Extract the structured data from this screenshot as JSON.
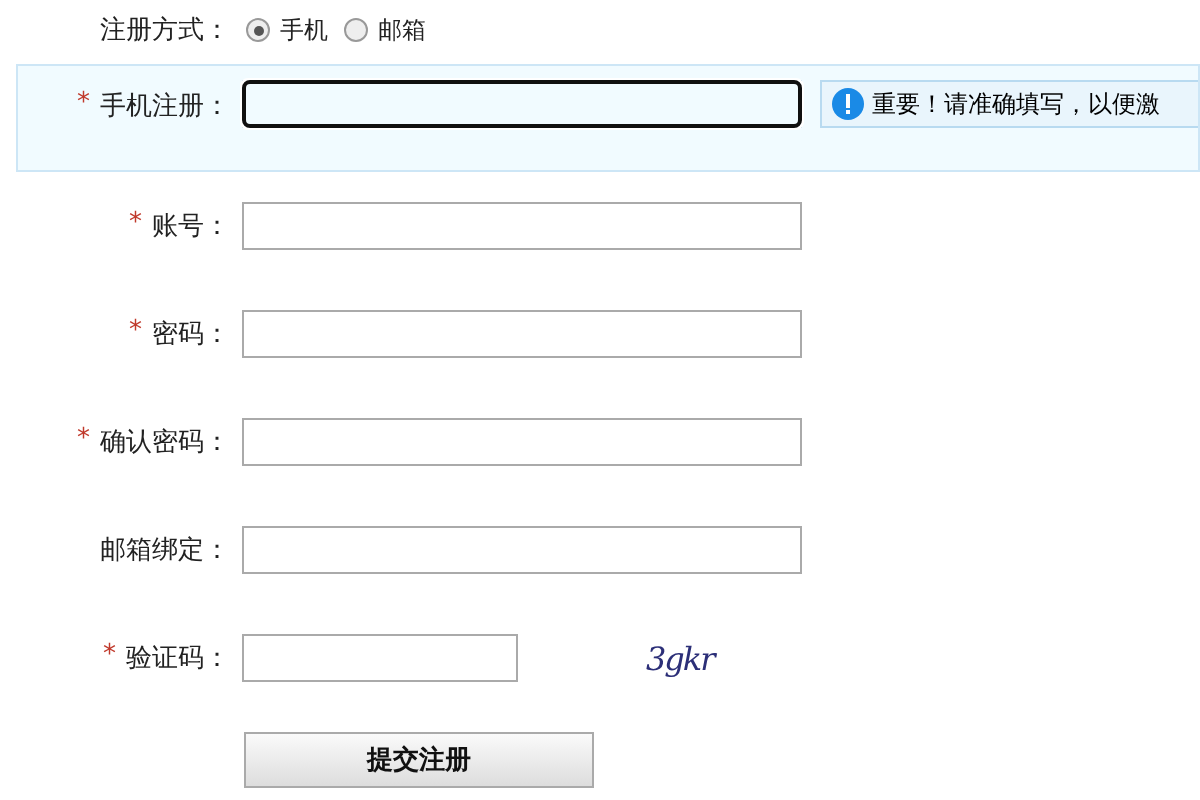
{
  "mode": {
    "label": "注册方式：",
    "options": [
      {
        "label": "手机",
        "selected": true
      },
      {
        "label": "邮箱",
        "selected": false
      }
    ]
  },
  "fields": [
    {
      "label": "手机注册：",
      "required": true,
      "focused": true,
      "hint": "重要！请准确填写，以便激"
    },
    {
      "label": "账号：",
      "required": true,
      "focused": false
    },
    {
      "label": "密码：",
      "required": true,
      "focused": false
    },
    {
      "label": "确认密码：",
      "required": true,
      "focused": false
    },
    {
      "label": "邮箱绑定：",
      "required": false,
      "focused": false
    },
    {
      "label": "验证码：",
      "required": true,
      "focused": false,
      "kind": "captcha",
      "captcha": "3gkr"
    }
  ],
  "required_mark": "*",
  "submit": "提交注册"
}
